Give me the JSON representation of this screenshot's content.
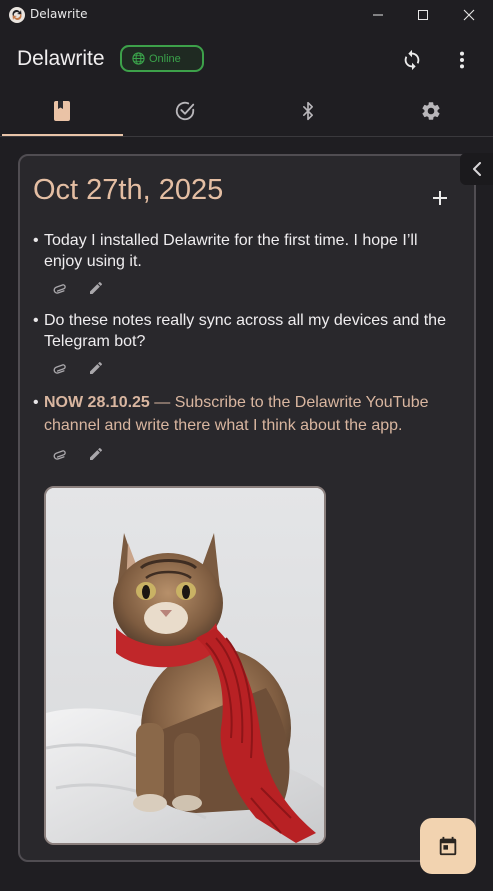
{
  "window": {
    "title": "Delawrite",
    "controls": [
      "minimize",
      "maximize",
      "close"
    ]
  },
  "header": {
    "app_title": "Delawrite",
    "status_badge": "Online",
    "actions": [
      "sync-icon",
      "more-vert-icon"
    ]
  },
  "tabs": [
    {
      "icon": "journal-icon",
      "active": true
    },
    {
      "icon": "check-circle-icon",
      "active": false
    },
    {
      "icon": "bluetooth-icon",
      "active": false
    },
    {
      "icon": "settings-gear-icon",
      "active": false
    }
  ],
  "journal": {
    "date": "Oct 27th, 2025",
    "notes": [
      {
        "text": "Today I installed Delawrite for the first time. I hope I’ll enjoy using it."
      },
      {
        "text": "Do these notes really sync across all my devices and the Telegram bot?"
      },
      {
        "prefix": "NOW 28.10.25",
        "separator": " — ",
        "text": "Subscribe to the Delawrite YouTube channel and write there what I think about the app."
      }
    ],
    "attachment": {
      "kind": "photo",
      "subject": "cat-with-red-scarf"
    }
  },
  "colors": {
    "background": "#1f1e22",
    "card": "#29282c",
    "accent_peach": "#e4bea3",
    "online_green": "#3da14a",
    "fab": "#f2d3b0"
  }
}
